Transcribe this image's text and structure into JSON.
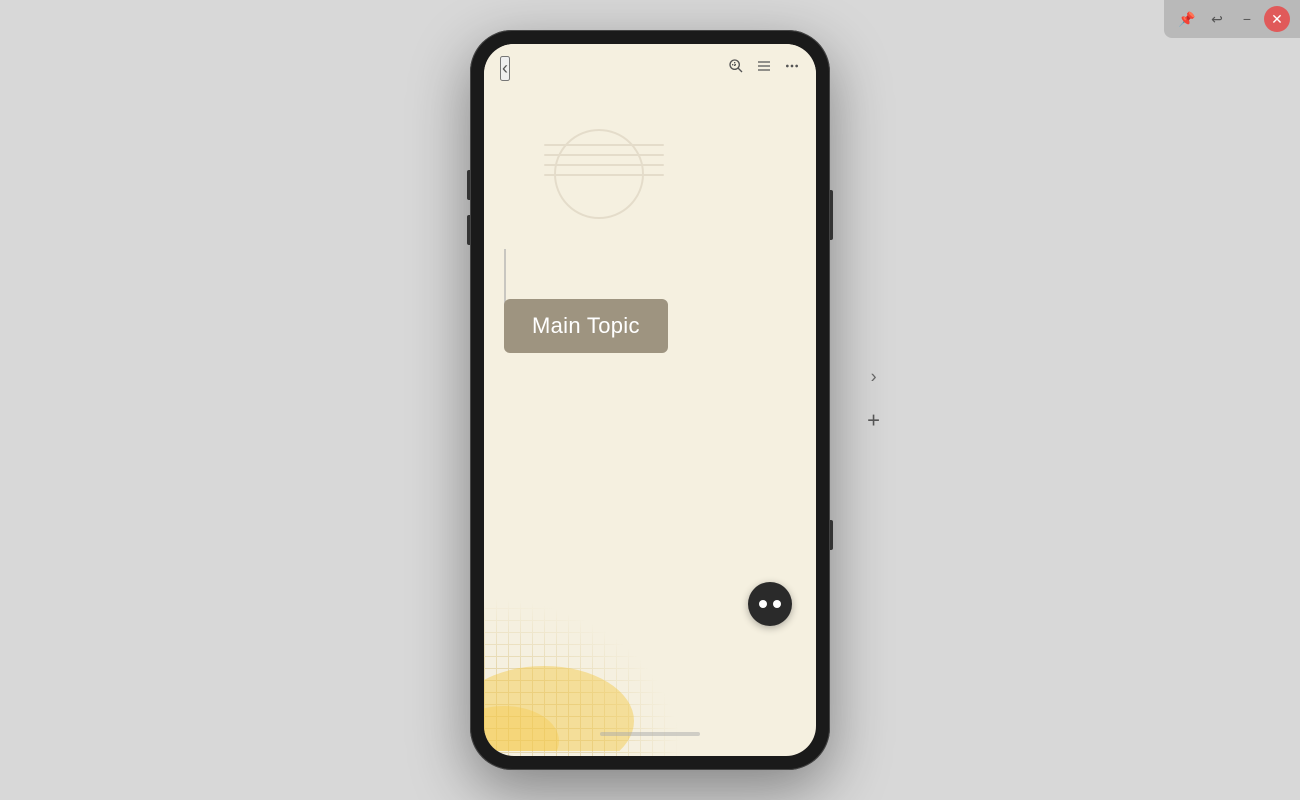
{
  "toolbar": {
    "pin_label": "📌",
    "undo_label": "↩",
    "minimize_label": "−",
    "close_label": "✕"
  },
  "phone": {
    "header": {
      "back_label": "‹",
      "search_icon": "🔍",
      "list_icon": "≡",
      "more_icon": "⋯"
    },
    "main_topic_label": "Main Topic",
    "ai_button_label": "AI"
  },
  "side_controls": {
    "arrow_label": "›",
    "plus_label": "+"
  },
  "background_color": "#d8d8d8",
  "screen_bg": "#f5f0e0",
  "topic_bg": "#9e9480",
  "blob_color": "#f0d060"
}
